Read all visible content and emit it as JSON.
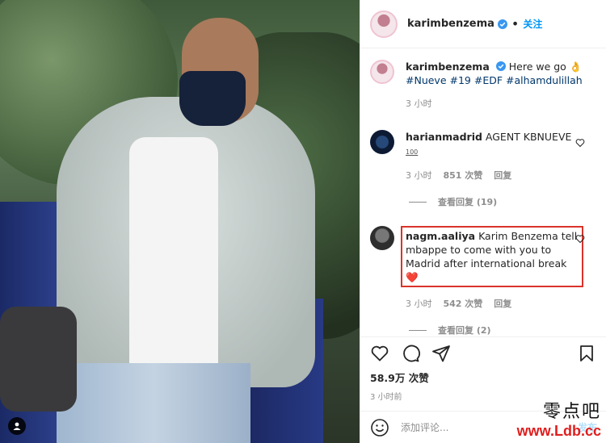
{
  "header": {
    "username": "karimbenzema",
    "dot": "•",
    "follow_label": "关注"
  },
  "caption": {
    "username": "karimbenzema",
    "text": "Here we go 👌",
    "hashtags": "#Nueve #19 #EDF #alhamdulillah",
    "time": "3 小时"
  },
  "comments": [
    {
      "username": "harianmadrid",
      "text": "AGENT KBNUEVE",
      "badge": "100",
      "time": "3 小时",
      "likes": "851 次赞",
      "reply": "回复",
      "view_replies": "查看回复 (19)"
    },
    {
      "username": "nagm.aaliya",
      "text": "Karim Benzema tell mbappe to come with you to Madrid after international break❤️",
      "time": "3 小时",
      "likes": "542 次赞",
      "reply": "回复",
      "view_replies": "查看回复 (2)"
    }
  ],
  "stats": {
    "likes": "58.9万 次赞",
    "time": "3 小时前"
  },
  "add_comment": {
    "placeholder": "添加评论...",
    "post_label": "发布"
  },
  "watermark": {
    "chinese": "零点吧",
    "url": "www.Ldb.cc"
  },
  "icons": {
    "verified": "verified-badge-icon",
    "like": "heart-icon",
    "comment": "comment-bubble-icon",
    "share": "paper-plane-icon",
    "save": "bookmark-icon",
    "emoji": "emoji-smile-icon",
    "user_tag": "user-tag-icon"
  },
  "colors": {
    "accent": "#0095f6",
    "highlight_border": "#d9342b",
    "watermark_url": "#e01e1e"
  }
}
